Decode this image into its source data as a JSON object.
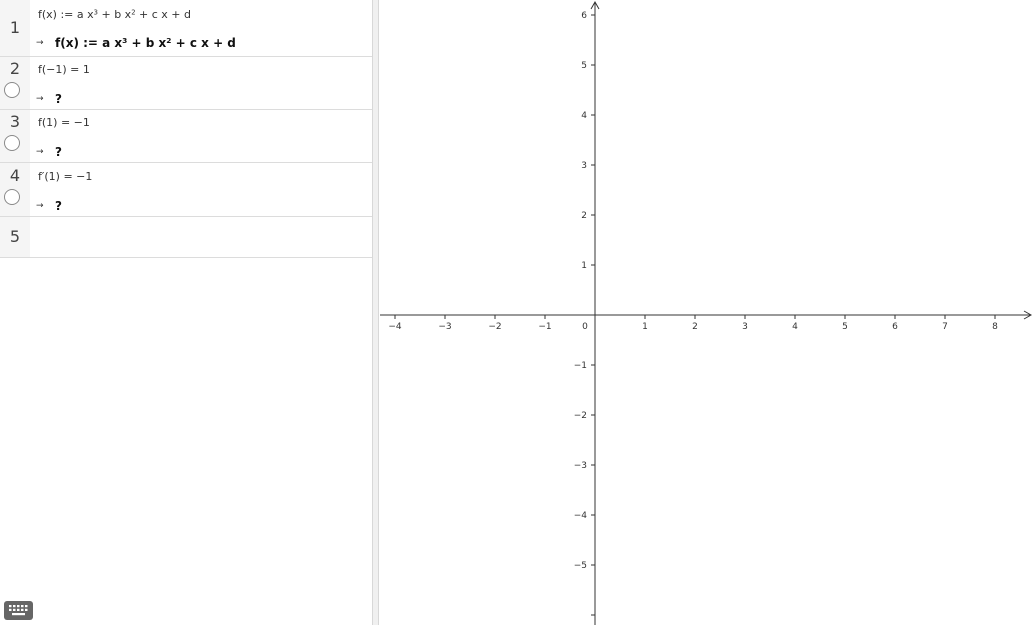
{
  "cas": {
    "rows": [
      {
        "num": "1",
        "input": {
          "pre": "f(x) := a x",
          "e1": "3",
          "mid": " + b x",
          "e2": "2",
          "post": " + c x + d"
        },
        "arrow": "→",
        "output": {
          "pre": "f(x) := a x",
          "e1": "3",
          "mid": " + b x",
          "e2": "2",
          "post": " + c x + d"
        }
      },
      {
        "num": "2",
        "input": "f(−1) = 1",
        "arrow": "→",
        "output": "?"
      },
      {
        "num": "3",
        "input": "f(1) = −1",
        "arrow": "→",
        "output": "?"
      },
      {
        "num": "4",
        "input": "f′(1) = −1",
        "arrow": "→",
        "output": "?"
      },
      {
        "num": "5"
      }
    ]
  },
  "graphics": {
    "x_ticks": [
      "−4",
      "−3",
      "−2",
      "−1",
      "1",
      "2",
      "3",
      "4",
      "5",
      "6",
      "7",
      "8"
    ],
    "x_values": [
      -4,
      -3,
      -2,
      -1,
      1,
      2,
      3,
      4,
      5,
      6,
      7,
      8
    ],
    "origin_label": "0",
    "y_ticks": [
      "6",
      "5",
      "4",
      "3",
      "2",
      "1",
      "−1",
      "−2",
      "−3",
      "−4",
      "−5"
    ],
    "y_values": [
      6,
      5,
      4,
      3,
      2,
      1,
      -1,
      -2,
      -3,
      -4,
      -5
    ],
    "axis_color": "#333333"
  },
  "icons": {
    "keyboard": "keyboard-icon"
  }
}
